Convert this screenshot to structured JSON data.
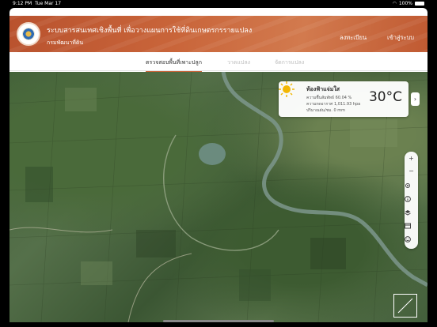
{
  "status_bar": {
    "time": "9:12 PM",
    "date": "Tue Mar 17",
    "battery": "100%"
  },
  "header": {
    "title": "ระบบสารสนเทศเชิงพื้นที่ เพื่อวางแผนการใช้ที่ดินเกษตรกรรายแปลง",
    "subtitle": "กรมพัฒนาที่ดิน",
    "register_label": "ลงทะเบียน",
    "login_label": "เข้าสู่ระบบ"
  },
  "tabs": [
    {
      "label": "ตรวจสอบพื้นที่เพาะปลูก",
      "active": true
    },
    {
      "label": "วาดแปลง",
      "active": false
    },
    {
      "label": "จัดการแปลง",
      "active": false
    }
  ],
  "weather": {
    "condition": "ท้องฟ้าแจ่มใส",
    "humidity": "ความชื้นสัมพัทธ์ 60.04 %",
    "pressure": "ความกดอากาศ 1,011.93 hpa",
    "rain": "ปริมาณฝน/ชม. 0 mm",
    "temperature": "30°C",
    "toggle_icon": "›"
  },
  "map_controls": {
    "zoom_in": "+",
    "zoom_out": "−",
    "icons": [
      "locate-icon",
      "info-icon",
      "layers-icon",
      "basemap-icon",
      "face-icon"
    ]
  },
  "colors": {
    "header_accent": "#c9653a",
    "map_water": "#6f8f86"
  }
}
